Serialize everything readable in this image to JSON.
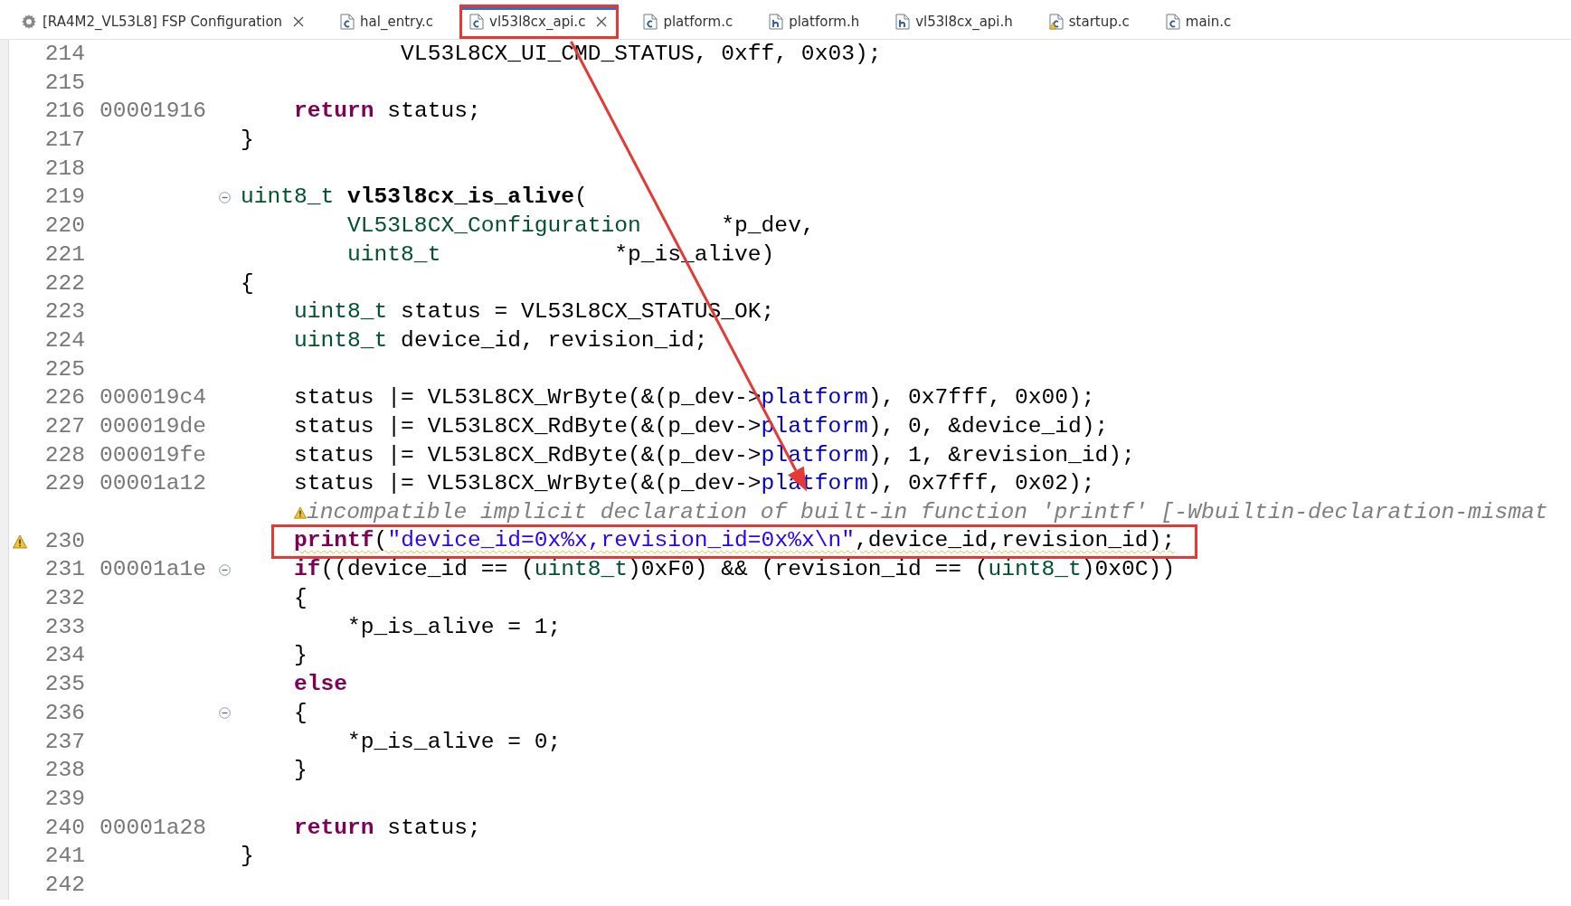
{
  "tabs": [
    {
      "label": "[RA4M2_VL53L8] FSP Configuration",
      "kind": "config",
      "selected": false,
      "closable": true,
      "highlighted": false
    },
    {
      "label": "hal_entry.c",
      "kind": "source",
      "selected": false,
      "closable": false,
      "highlighted": false
    },
    {
      "label": "vl53l8cx_api.c",
      "kind": "source",
      "selected": true,
      "closable": true,
      "highlighted": true
    },
    {
      "label": "platform.c",
      "kind": "source",
      "selected": false,
      "closable": false,
      "highlighted": false
    },
    {
      "label": "platform.h",
      "kind": "header",
      "selected": false,
      "closable": false,
      "highlighted": false
    },
    {
      "label": "vl53l8cx_api.h",
      "kind": "header",
      "selected": false,
      "closable": false,
      "highlighted": false
    },
    {
      "label": "startup.c",
      "kind": "source-warning",
      "selected": false,
      "closable": false,
      "highlighted": false
    },
    {
      "label": "main.c",
      "kind": "source",
      "selected": false,
      "closable": false,
      "highlighted": false
    }
  ],
  "editor": {
    "arrow": true,
    "lines": [
      {
        "kind": "code",
        "number": "214",
        "code": [
          {
            "text": "            VL53L8CX_UI_CMD_STATUS, 0xff, 0x03);",
            "kind": "plain"
          }
        ]
      },
      {
        "kind": "code",
        "number": "215"
      },
      {
        "kind": "code",
        "number": "216",
        "address": "00001916",
        "code": [
          {
            "text": "    return",
            "kind": "keyword"
          },
          {
            "text": " status;",
            "kind": "plain"
          }
        ]
      },
      {
        "kind": "code",
        "number": "217",
        "code": [
          {
            "text": "}",
            "kind": "plain"
          }
        ]
      },
      {
        "kind": "code",
        "number": "218"
      },
      {
        "kind": "code",
        "number": "219",
        "foldable": true,
        "code": [
          {
            "text": "uint8_t",
            "kind": "type"
          },
          {
            "text": " vl53l8cx_is_alive",
            "kind": "function"
          },
          {
            "text": "(",
            "kind": "plain"
          }
        ]
      },
      {
        "kind": "code",
        "number": "220",
        "code": [
          {
            "text": "        VL53L8CX_Configuration",
            "kind": "type"
          },
          {
            "text": "      *p_dev,",
            "kind": "plain"
          }
        ]
      },
      {
        "kind": "code",
        "number": "221",
        "code": [
          {
            "text": "        uint8_t",
            "kind": "type"
          },
          {
            "text": "             *p_is_alive)",
            "kind": "plain"
          }
        ]
      },
      {
        "kind": "code",
        "number": "222",
        "code": [
          {
            "text": "{",
            "kind": "plain"
          }
        ]
      },
      {
        "kind": "code",
        "number": "223",
        "code": [
          {
            "text": "    uint8_t",
            "kind": "type"
          },
          {
            "text": " status = VL53L8CX_STATUS_OK;",
            "kind": "plain"
          }
        ]
      },
      {
        "kind": "code",
        "number": "224",
        "code": [
          {
            "text": "    uint8_t",
            "kind": "type"
          },
          {
            "text": " device_id, revision_id;",
            "kind": "plain"
          }
        ]
      },
      {
        "kind": "code",
        "number": "225"
      },
      {
        "kind": "code",
        "number": "226",
        "address": "000019c4",
        "code": [
          {
            "text": "    status |= VL53L8CX_WrByte(&(p_dev->",
            "kind": "plain"
          },
          {
            "text": "platform",
            "kind": "field"
          },
          {
            "text": "), 0x7fff, 0x00);",
            "kind": "plain"
          }
        ]
      },
      {
        "kind": "code",
        "number": "227",
        "address": "000019de",
        "code": [
          {
            "text": "    status |= VL53L8CX_RdByte(&(p_dev->",
            "kind": "plain"
          },
          {
            "text": "platform",
            "kind": "field"
          },
          {
            "text": "), 0, &device_id);",
            "kind": "plain"
          }
        ]
      },
      {
        "kind": "code",
        "number": "228",
        "address": "000019fe",
        "code": [
          {
            "text": "    status |= VL53L8CX_RdByte(&(p_dev->",
            "kind": "plain"
          },
          {
            "text": "platform",
            "kind": "field"
          },
          {
            "text": "), 1, &revision_id);",
            "kind": "plain"
          }
        ]
      },
      {
        "kind": "code",
        "number": "229",
        "address": "00001a12",
        "code": [
          {
            "text": "    status |= VL53L8CX_WrByte(&(p_dev->",
            "kind": "plain"
          },
          {
            "text": "platform",
            "kind": "field"
          },
          {
            "text": "), 0x7fff, 0x02);",
            "kind": "plain"
          }
        ]
      },
      {
        "kind": "annotation",
        "text": "incompatible implicit declaration of built-in function 'printf' [-Wbuiltin-declaration-mismat"
      },
      {
        "kind": "code",
        "number": "230",
        "warning": true,
        "highlighted": true,
        "code": [
          {
            "text": "    printf",
            "kind": "keyword"
          },
          {
            "text": "(",
            "kind": "plain"
          },
          {
            "text": "\"device_id=0x%x,revision_id=0x%x\\n\"",
            "kind": "string"
          },
          {
            "text": ",device_id,revision_id);",
            "kind": "plain"
          }
        ]
      },
      {
        "kind": "code",
        "number": "231",
        "address": "00001a1e",
        "foldable": true,
        "code": [
          {
            "text": "    if",
            "kind": "keyword"
          },
          {
            "text": "((device_id == (",
            "kind": "plain"
          },
          {
            "text": "uint8_t",
            "kind": "type"
          },
          {
            "text": ")0xF0) && (revision_id == (",
            "kind": "plain"
          },
          {
            "text": "uint8_t",
            "kind": "type"
          },
          {
            "text": ")0x0C))",
            "kind": "plain"
          }
        ]
      },
      {
        "kind": "code",
        "number": "232",
        "code": [
          {
            "text": "    {",
            "kind": "plain"
          }
        ]
      },
      {
        "kind": "code",
        "number": "233",
        "code": [
          {
            "text": "        *p_is_alive = 1;",
            "kind": "plain"
          }
        ]
      },
      {
        "kind": "code",
        "number": "234",
        "code": [
          {
            "text": "    }",
            "kind": "plain"
          }
        ]
      },
      {
        "kind": "code",
        "number": "235",
        "code": [
          {
            "text": "    else",
            "kind": "keyword"
          }
        ]
      },
      {
        "kind": "code",
        "number": "236",
        "foldable": true,
        "code": [
          {
            "text": "    {",
            "kind": "plain"
          }
        ]
      },
      {
        "kind": "code",
        "number": "237",
        "code": [
          {
            "text": "        *p_is_alive = 0;",
            "kind": "plain"
          }
        ]
      },
      {
        "kind": "code",
        "number": "238",
        "code": [
          {
            "text": "    }",
            "kind": "plain"
          }
        ]
      },
      {
        "kind": "code",
        "number": "239"
      },
      {
        "kind": "code",
        "number": "240",
        "address": "00001a28",
        "code": [
          {
            "text": "    return",
            "kind": "keyword"
          },
          {
            "text": " status;",
            "kind": "plain"
          }
        ]
      },
      {
        "kind": "code",
        "number": "241",
        "code": [
          {
            "text": "}",
            "kind": "plain"
          }
        ]
      },
      {
        "kind": "code",
        "number": "242"
      }
    ]
  }
}
